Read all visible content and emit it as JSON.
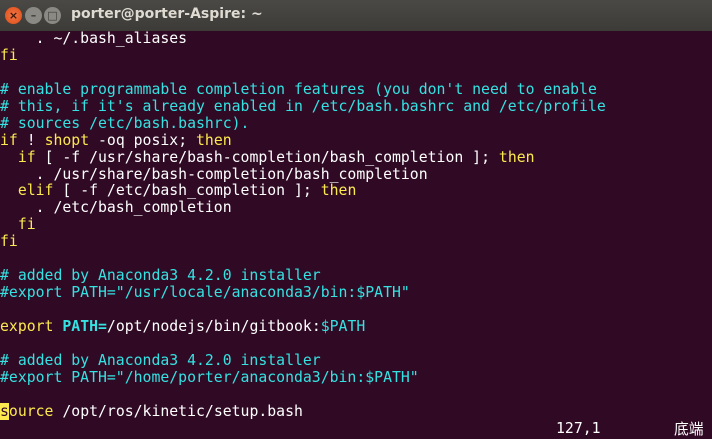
{
  "window": {
    "title": "porter@porter-Aspire: ~",
    "close_glyph": "×",
    "min_glyph": "–",
    "max_glyph": "□"
  },
  "colors": {
    "background": "#300a24",
    "comment": "#34e2e2",
    "keyword": "#fce94f",
    "text": "#ffffff"
  },
  "lines": [
    [
      [
        "t",
        "    . ~/.bash_aliases"
      ]
    ],
    [
      [
        "k",
        "fi"
      ]
    ],
    [],
    [
      [
        "c",
        "# enable programmable completion features (you don't need to enable"
      ]
    ],
    [
      [
        "c",
        "# this, if it's already enabled in /etc/bash.bashrc and /etc/profile"
      ]
    ],
    [
      [
        "c",
        "# sources /etc/bash.bashrc)."
      ]
    ],
    [
      [
        "k",
        "if"
      ],
      [
        "t",
        " ! "
      ],
      [
        "k",
        "shopt"
      ],
      [
        "t",
        " -oq posix; "
      ],
      [
        "k",
        "then"
      ]
    ],
    [
      [
        "t",
        "  "
      ],
      [
        "k",
        "if"
      ],
      [
        "t",
        " [ -f /usr/share/bash-completion/bash_completion ]; "
      ],
      [
        "k",
        "then"
      ]
    ],
    [
      [
        "t",
        "    . /usr/share/bash-completion/bash_completion"
      ]
    ],
    [
      [
        "t",
        "  "
      ],
      [
        "k",
        "elif"
      ],
      [
        "t",
        " [ -f /etc/bash_completion ]; "
      ],
      [
        "k",
        "then"
      ]
    ],
    [
      [
        "t",
        "    . /etc/bash_completion"
      ]
    ],
    [
      [
        "t",
        "  "
      ],
      [
        "k",
        "fi"
      ]
    ],
    [
      [
        "k",
        "fi"
      ]
    ],
    [],
    [
      [
        "c",
        "# added by Anaconda3 4.2.0 installer"
      ]
    ],
    [
      [
        "c",
        "#export PATH=\"/usr/locale/anaconda3/bin:$PATH\""
      ]
    ],
    [],
    [
      [
        "k",
        "export"
      ],
      [
        "t",
        " "
      ],
      [
        "v",
        "PATH="
      ],
      [
        "t",
        "/opt/nodejs/bin/gitbook:"
      ],
      [
        "c",
        "$PATH"
      ]
    ],
    [],
    [
      [
        "c",
        "# added by Anaconda3 4.2.0 installer"
      ]
    ],
    [
      [
        "c",
        "#export PATH=\"/home/porter/anaconda3/bin:$PATH\""
      ]
    ],
    [],
    [
      [
        "cursor",
        "s"
      ],
      [
        "k",
        "ource"
      ],
      [
        "t",
        " /opt/ros/kinetic/setup.bash"
      ]
    ]
  ],
  "status": {
    "position": "127,1",
    "scroll": "底端"
  }
}
